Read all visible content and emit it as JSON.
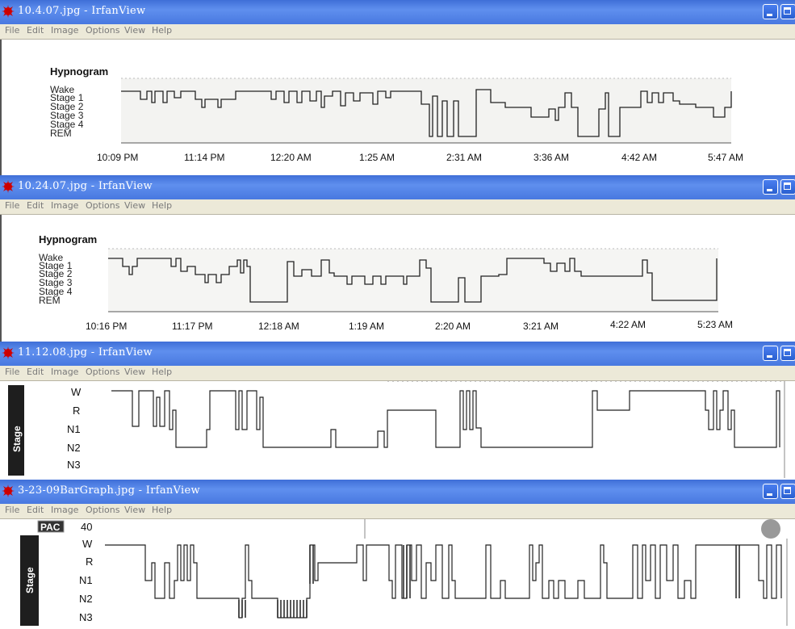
{
  "menu": [
    "File",
    "Edit",
    "Image",
    "Options",
    "View",
    "Help"
  ],
  "windows": [
    {
      "title": "10.4.07.jpg - IrfanView",
      "plot_title": "Hypnogram",
      "stages": [
        "Wake",
        "Stage 1",
        "Stage 2",
        "Stage 3",
        "Stage 4",
        "REM"
      ],
      "times": [
        "10:09 PM",
        "11:14 PM",
        "12:20 AM",
        "1:25 AM",
        "2:31 AM",
        "3:36 AM",
        "4:42 AM",
        "5:47 AM"
      ]
    },
    {
      "title": "10.24.07.jpg - IrfanView",
      "plot_title": "Hypnogram",
      "stages": [
        "Wake",
        "Stage 1",
        "Stage 2",
        "Stage 3",
        "Stage 4",
        "REM"
      ],
      "times": [
        "10:16 PM",
        "11:17 PM",
        "12:18 AM",
        "1:19 AM",
        "2:20 AM",
        "3:21 AM",
        "4:22 AM",
        "5:23 AM"
      ]
    },
    {
      "title": "11.12.08.jpg - IrfanView",
      "axis_label": "Stage",
      "stages": [
        "W",
        "R",
        "N1",
        "N2",
        "N3"
      ]
    },
    {
      "title": "3-23-09BarGraph.jpg - IrfanView",
      "pac_label": "PAC",
      "pac_value": "40",
      "axis_label": "Stage",
      "stages": [
        "W",
        "R",
        "N1",
        "N2",
        "N3"
      ]
    }
  ],
  "chart_data": [
    {
      "type": "line",
      "title": "Hypnogram",
      "y_categories": [
        "Wake",
        "Stage 1",
        "Stage 2",
        "Stage 3",
        "Stage 4",
        "REM"
      ],
      "x_ticks": [
        "10:09 PM",
        "11:14 PM",
        "12:20 AM",
        "1:25 AM",
        "2:31 AM",
        "3:36 AM",
        "4:42 AM",
        "5:47 AM"
      ],
      "series": [
        {
          "x": [
            0,
            0.05,
            0.05,
            0.12,
            0.12,
            0.2,
            0.2,
            0.25,
            0.25,
            0.35,
            0.35,
            0.38,
            0.38,
            0.45,
            0.45,
            0.52,
            0.52,
            0.55,
            0.55,
            0.58,
            0.58,
            0.6,
            0.6,
            0.63,
            0.63,
            0.7,
            0.7,
            0.72,
            0.72,
            0.75,
            0.75,
            0.8,
            0.8,
            0.85,
            0.85,
            0.88,
            0.88,
            0.93,
            0.93,
            1.0
          ],
          "y": [
            "Stage 1",
            "Stage 1",
            "Stage 2",
            "Stage 2",
            "Stage 1",
            "Stage 1",
            "Stage 2",
            "Stage 2",
            "Stage 1",
            "Stage 1",
            "Stage 2",
            "Stage 2",
            "Stage 1",
            "Stage 1",
            "Wake",
            "Wake",
            "Stage 1",
            "Stage 1",
            "REM",
            "REM",
            "Wake",
            "Wake",
            "Stage 2",
            "Stage 2",
            "Stage 3",
            "Stage 3",
            "Stage 2",
            "Stage 2",
            "Stage 1",
            "Stage 1",
            "REM",
            "REM",
            "Stage 1",
            "Stage 1",
            "Wake",
            "Wake",
            "Stage 1",
            "Stage 1",
            "Stage 2",
            "Stage 2"
          ]
        }
      ]
    },
    {
      "type": "line",
      "title": "Hypnogram",
      "y_categories": [
        "Wake",
        "Stage 1",
        "Stage 2",
        "Stage 3",
        "Stage 4",
        "REM"
      ],
      "x_ticks": [
        "10:16 PM",
        "11:17 PM",
        "12:18 AM",
        "1:19 AM",
        "2:20 AM",
        "3:21 AM",
        "4:22 AM",
        "5:23 AM"
      ],
      "series": [
        {
          "x": [
            0,
            0.04,
            0.04,
            0.1,
            0.1,
            0.16,
            0.16,
            0.23,
            0.23,
            0.3,
            0.3,
            0.35,
            0.35,
            0.46,
            0.46,
            0.52,
            0.52,
            0.57,
            0.57,
            0.63,
            0.63,
            0.73,
            0.73,
            0.88,
            0.88,
            1.0
          ],
          "y": [
            "Stage 1",
            "Stage 1",
            "Stage 2",
            "Stage 2",
            "Stage 1",
            "Stage 1",
            "Stage 2",
            "Stage 2",
            "REM",
            "REM",
            "Stage 2",
            "Stage 2",
            "Stage 3",
            "Stage 3",
            "Stage 1",
            "Stage 1",
            "REM",
            "REM",
            "Stage 3",
            "Stage 3",
            "Stage 1",
            "Stage 1",
            "Stage 2",
            "Stage 2",
            "REM",
            "REM"
          ]
        }
      ]
    },
    {
      "type": "line",
      "ylabel": "Stage",
      "y_categories": [
        "W",
        "R",
        "N1",
        "N2",
        "N3"
      ],
      "series": [
        {
          "x": [
            0,
            0.03,
            0.03,
            0.08,
            0.08,
            0.15,
            0.15,
            0.2,
            0.2,
            0.33,
            0.33,
            0.35,
            0.35,
            0.43,
            0.43,
            0.5,
            0.5,
            0.52,
            0.52,
            0.73,
            0.73,
            0.78,
            0.78,
            0.9,
            0.9,
            0.95,
            0.95,
            1.0
          ],
          "y": [
            "W",
            "W",
            "N2",
            "N2",
            "W",
            "W",
            "N2",
            "N2",
            "N3",
            "N3",
            "N2",
            "N2",
            "W",
            "W",
            "R",
            "R",
            "W",
            "W",
            "N3",
            "N3",
            "R",
            "R",
            "W",
            "W",
            "N2",
            "N2",
            "W",
            "W"
          ]
        }
      ]
    },
    {
      "type": "line",
      "ylabel": "Stage",
      "y_categories": [
        "W",
        "R",
        "N1",
        "N2",
        "N3"
      ],
      "series": [
        {
          "x": [
            0,
            0.05,
            0.05,
            0.1,
            0.1,
            0.18,
            0.18,
            0.25,
            0.25,
            0.3,
            0.3,
            0.38,
            0.38,
            0.45,
            0.45,
            0.55,
            0.55,
            0.65,
            0.65,
            0.73,
            0.73,
            0.82,
            0.82,
            0.88,
            0.88,
            1.0
          ],
          "y": [
            "W",
            "W",
            "N2",
            "N2",
            "W",
            "W",
            "N2",
            "N2",
            "N3",
            "N3",
            "R",
            "R",
            "W",
            "W",
            "N2",
            "N2",
            "N1",
            "N1",
            "N2",
            "N2",
            "W",
            "W",
            "N2",
            "N2",
            "W",
            "W"
          ]
        }
      ]
    }
  ]
}
